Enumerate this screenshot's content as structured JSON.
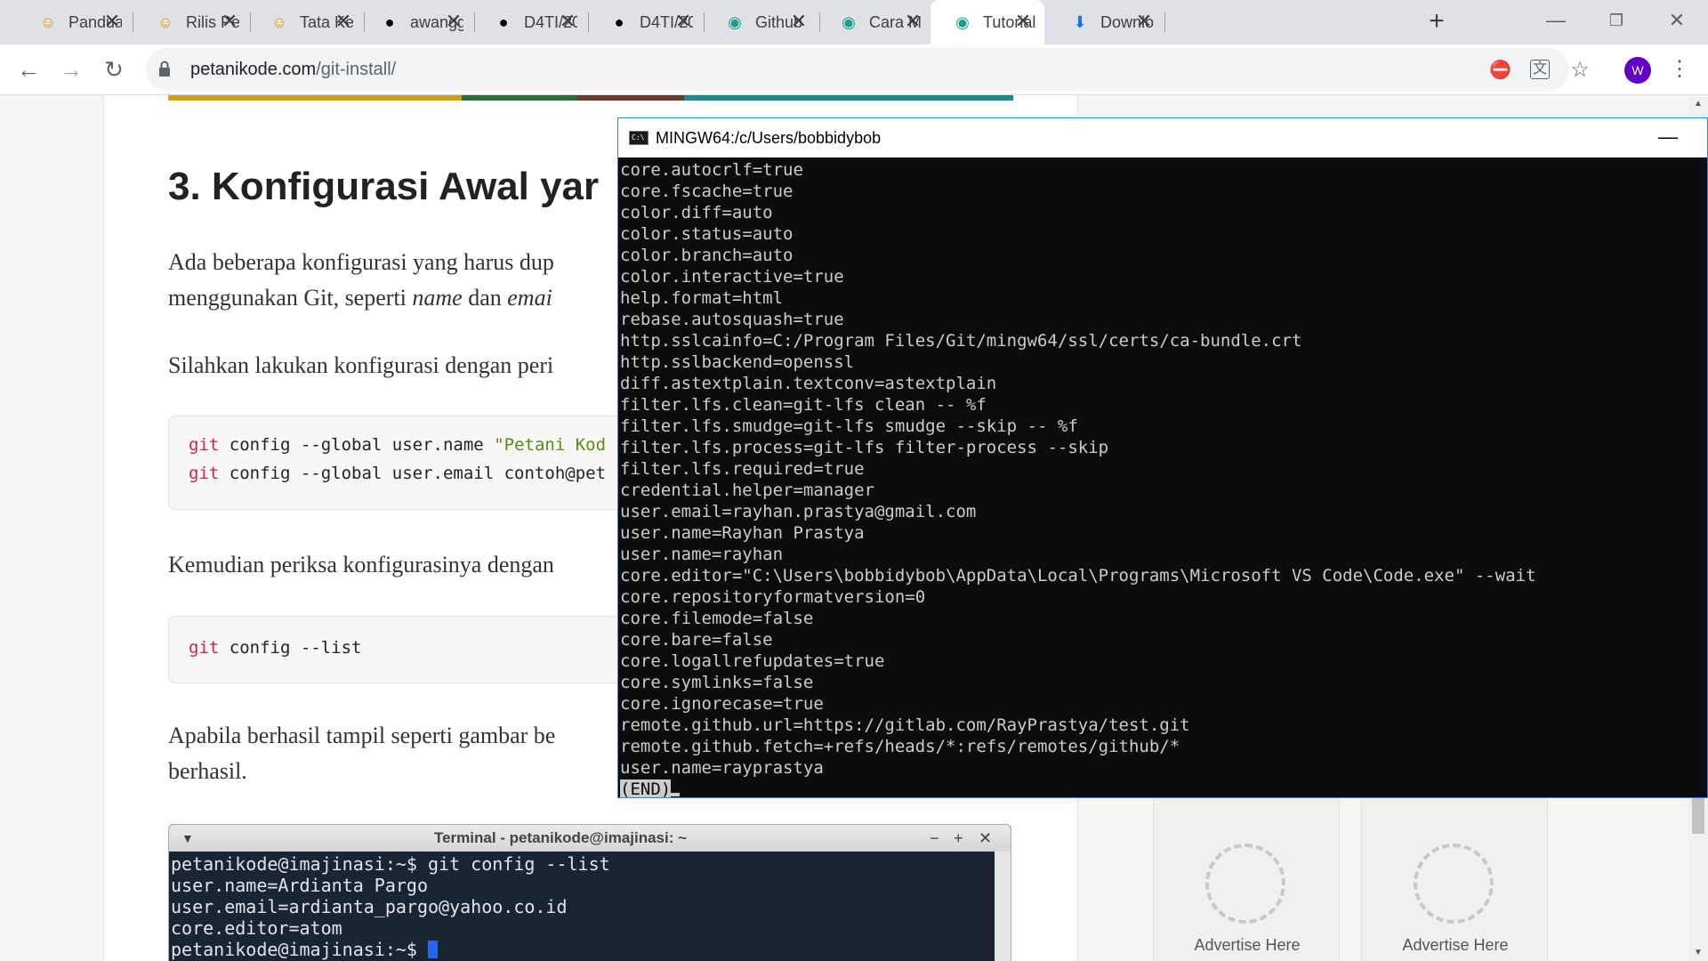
{
  "tabs": [
    {
      "label": "Pandua",
      "icon": "☺",
      "icon_color": "#e0a100"
    },
    {
      "label": "Rilis Pe",
      "icon": "☺",
      "icon_color": "#e0a100"
    },
    {
      "label": "Tata Kel",
      "icon": "☺",
      "icon_color": "#e0a100"
    },
    {
      "label": "awangg",
      "icon": "●",
      "icon_color": "#000000"
    },
    {
      "label": "D4TI/20",
      "icon": "●",
      "icon_color": "#000000"
    },
    {
      "label": "D4TI/20",
      "icon": "●",
      "icon_color": "#000000"
    },
    {
      "label": "Github",
      "icon": "◉",
      "icon_color": "#1e9c8e"
    },
    {
      "label": "Cara M",
      "icon": "◉",
      "icon_color": "#1e9c8e"
    },
    {
      "label": "Tutorial",
      "icon": "◉",
      "icon_color": "#1e9c8e",
      "active": true
    },
    {
      "label": "Downlo",
      "icon": "⬇",
      "icon_color": "#1a73e8"
    }
  ],
  "toolbar": {
    "url_host": "petanikode.com",
    "url_path": "/git-install/",
    "avatar_letter": "W"
  },
  "article": {
    "heading": "3. Konfigurasi Awal yar",
    "para1_line1": "Ada beberapa konfigurasi yang harus dup",
    "para1_line2_a": "menggunakan Git, seperti ",
    "para1_line2_name": "name",
    "para1_line2_b": " dan ",
    "para1_line2_email": "emai",
    "para2": "Silahkan lakukan konfigurasi dengan peri",
    "code1_l1_kw": "git",
    "code1_l1_rest": " config --global user.name ",
    "code1_l1_str": "\"Petani Kod",
    "code1_l2_kw": "git",
    "code1_l2_rest": " config --global user.email contoh@pet",
    "para3": "Kemudian periksa konfigurasinya dengan",
    "code2_kw": "git",
    "code2_rest": " config --list",
    "para4_line1": "Apabila berhasil tampil seperti gambar be",
    "para4_line2": "berhasil."
  },
  "image_terminal": {
    "title": "Terminal - petanikode@imajinasi: ~",
    "lines": [
      "petanikode@imajinasi:~$ git config --list",
      "user.name=Ardianta Pargo",
      "user.email=ardianta_pargo@yahoo.co.id",
      "core.editor=atom",
      "petanikode@imajinasi:~$ "
    ]
  },
  "ads": [
    "Advertise Here",
    "Advertise Here"
  ],
  "mingw": {
    "title": "MINGW64:/c/Users/bobbidybob",
    "lines": [
      "core.autocrlf=true",
      "core.fscache=true",
      "color.diff=auto",
      "color.status=auto",
      "color.branch=auto",
      "color.interactive=true",
      "help.format=html",
      "rebase.autosquash=true",
      "http.sslcainfo=C:/Program Files/Git/mingw64/ssl/certs/ca-bundle.crt",
      "http.sslbackend=openssl",
      "diff.astextplain.textconv=astextplain",
      "filter.lfs.clean=git-lfs clean -- %f",
      "filter.lfs.smudge=git-lfs smudge --skip -- %f",
      "filter.lfs.process=git-lfs filter-process --skip",
      "filter.lfs.required=true",
      "credential.helper=manager",
      "user.email=rayhan.prastya@gmail.com",
      "user.name=Rayhan Prastya",
      "user.name=rayhan",
      "core.editor=\"C:\\Users\\bobbidybob\\AppData\\Local\\Programs\\Microsoft VS Code\\Code.exe\" --wait",
      "core.repositoryformatversion=0",
      "core.filemode=false",
      "core.bare=false",
      "core.logallrefupdates=true",
      "core.symlinks=false",
      "core.ignorecase=true",
      "remote.github.url=https://gitlab.com/RayPrastya/test.git",
      "remote.github.fetch=+refs/heads/*:refs/remotes/github/*",
      "user.name=rayprastya"
    ],
    "end_marker": "(END)"
  }
}
